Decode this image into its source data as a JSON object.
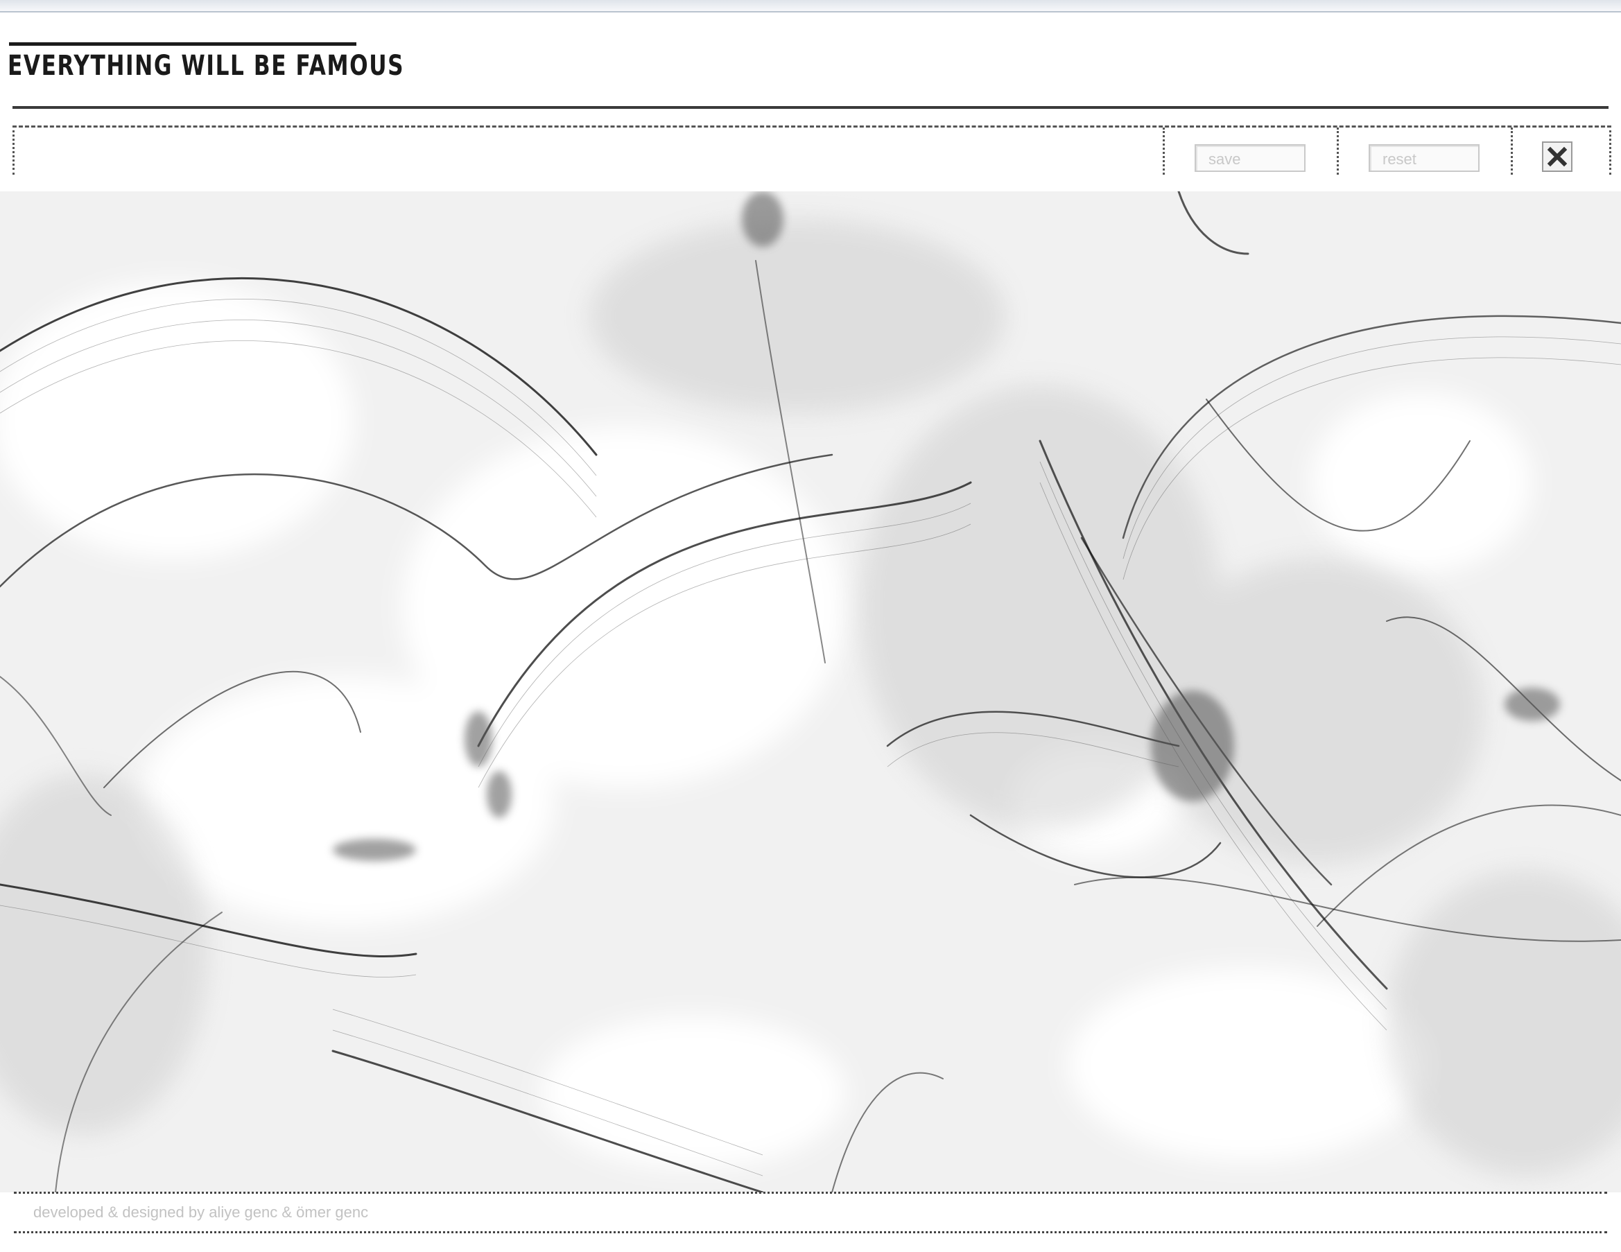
{
  "header": {
    "title": "EVERYTHING WILL BE FAMOUS"
  },
  "toolbar": {
    "save_label": "save",
    "reset_label": "reset",
    "close_icon": "close-x-icon"
  },
  "footer": {
    "credit": "developed & designed by aliye genc & ömer genc"
  },
  "colors": {
    "ink": "#1a1a1a",
    "canvas_bg": "#f1f1f1",
    "muted_text": "#c2c2c2"
  }
}
